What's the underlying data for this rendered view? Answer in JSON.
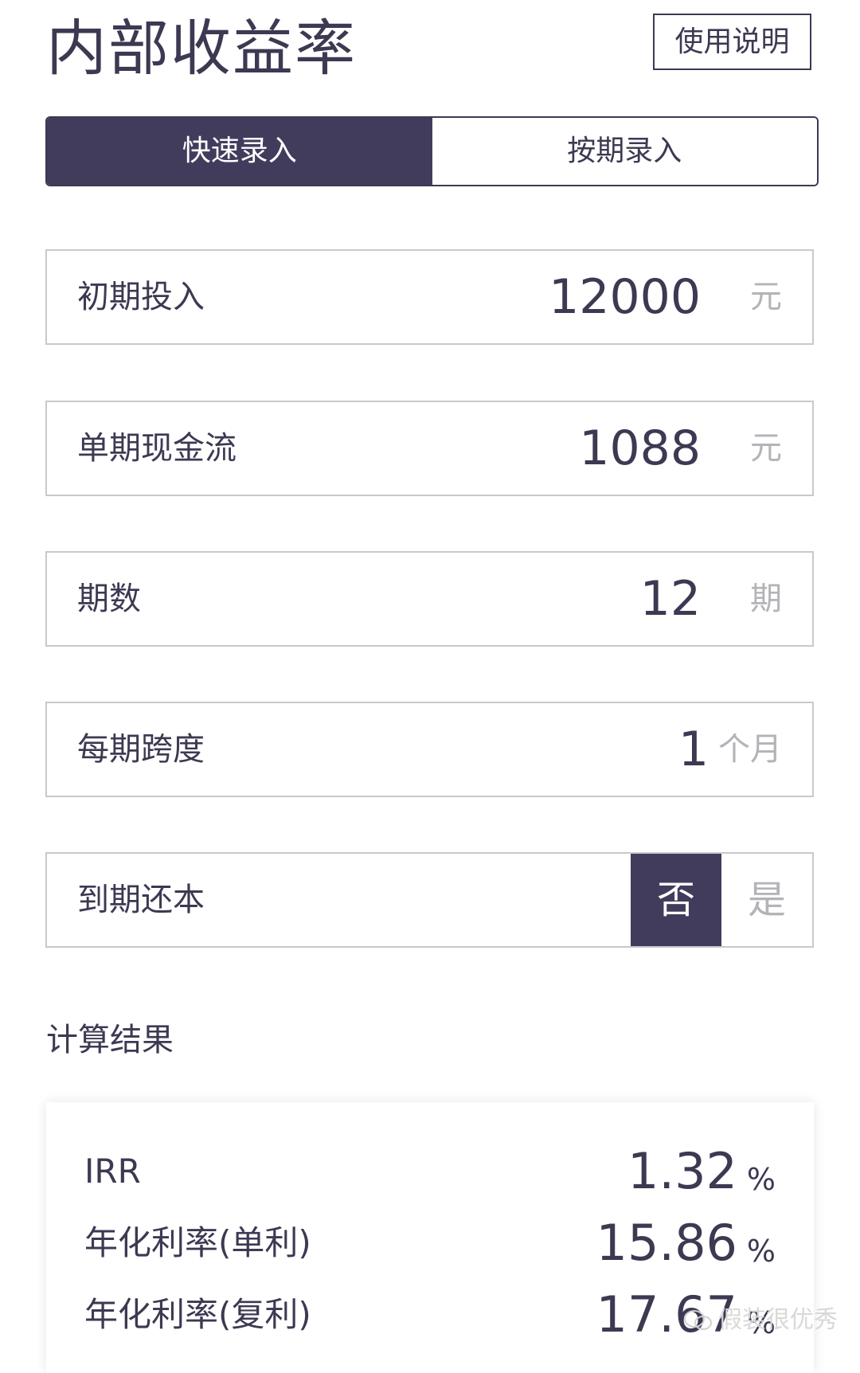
{
  "header": {
    "title": "内部收益率",
    "help_label": "使用说明"
  },
  "tabs": [
    {
      "label": "快速录入",
      "active": true
    },
    {
      "label": "按期录入",
      "active": false
    }
  ],
  "fields": {
    "initial_investment": {
      "label": "初期投入",
      "value": "12000",
      "unit": "元"
    },
    "cash_flow": {
      "label": "单期现金流",
      "value": "1088",
      "unit": "元"
    },
    "periods": {
      "label": "期数",
      "value": "12",
      "unit": "期"
    },
    "span": {
      "label": "每期跨度",
      "value": "1",
      "unit": "个月"
    },
    "repay_principal": {
      "label": "到期还本",
      "option_no": "否",
      "option_yes": "是",
      "selected": "否"
    }
  },
  "results": {
    "section_title": "计算结果",
    "rows": [
      {
        "label": "IRR",
        "value": "1.32",
        "unit": "%"
      },
      {
        "label": "年化利率(单利)",
        "value": "15.86",
        "unit": "%"
      },
      {
        "label": "年化利率(复利)",
        "value": "17.67",
        "unit": "%"
      }
    ]
  },
  "watermark": {
    "text": "假装很优秀"
  },
  "colors": {
    "primary": "#423c5c",
    "border": "#c9c9cd",
    "muted": "#b3b3b8",
    "text": "#3d3952"
  }
}
